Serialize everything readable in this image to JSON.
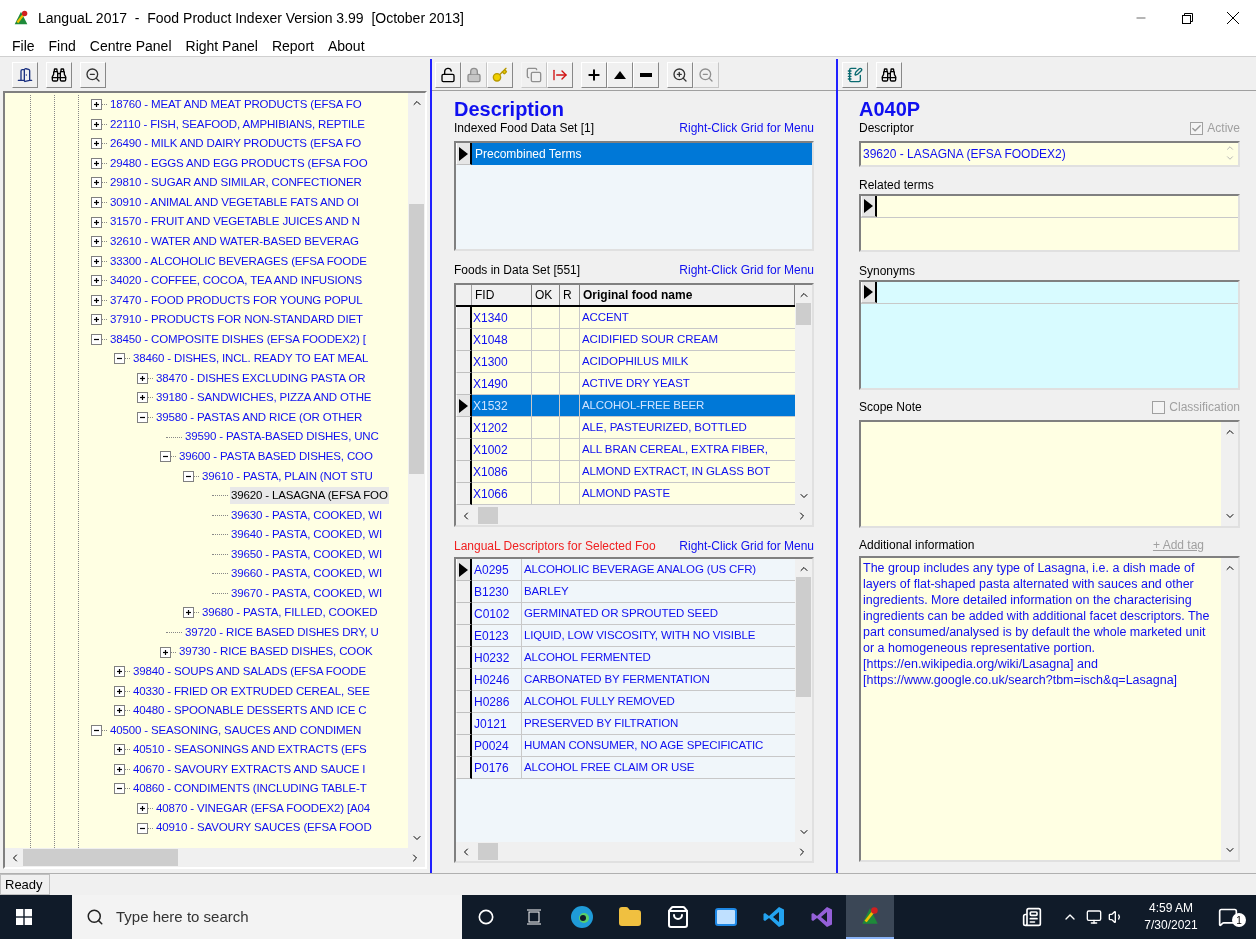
{
  "window": {
    "title": "LanguaL 2017  -  Food Product Indexer Version 3.99  [October 2013]"
  },
  "menu": [
    "File",
    "Find",
    "Centre Panel",
    "Right Panel",
    "Report",
    "About"
  ],
  "tree": [
    {
      "label": "18760 - MEAT AND MEAT PRODUCTS (EFSA FO",
      "kind": "branch",
      "expanded": false,
      "selected": false
    },
    {
      "label": "22110 - FISH, SEAFOOD, AMPHIBIANS, REPTILE",
      "kind": "branch",
      "expanded": false,
      "selected": false
    },
    {
      "label": "26490 - MILK AND DAIRY PRODUCTS (EFSA FO",
      "kind": "branch",
      "expanded": false,
      "selected": false
    },
    {
      "label": "29480 - EGGS AND EGG PRODUCTS (EFSA FOO",
      "kind": "branch",
      "expanded": false,
      "selected": false
    },
    {
      "label": "29810 - SUGAR AND SIMILAR, CONFECTIONER",
      "kind": "branch",
      "expanded": false,
      "selected": false
    },
    {
      "label": "30910 - ANIMAL AND VEGETABLE FATS AND OI",
      "kind": "branch",
      "expanded": false,
      "selected": false
    },
    {
      "label": "31570 - FRUIT AND VEGETABLE JUICES AND N",
      "kind": "branch",
      "expanded": false,
      "selected": false
    },
    {
      "label": "32610 - WATER AND WATER-BASED BEVERAG",
      "kind": "branch",
      "expanded": false,
      "selected": false
    },
    {
      "label": "33300 - ALCOHOLIC BEVERAGES (EFSA FOODE",
      "kind": "branch",
      "expanded": false,
      "selected": false
    },
    {
      "label": "34020 - COFFEE, COCOA, TEA AND INFUSIONS",
      "kind": "branch",
      "expanded": false,
      "selected": false
    },
    {
      "label": "37470 - FOOD PRODUCTS FOR YOUNG POPUL",
      "kind": "branch",
      "expanded": false,
      "selected": false
    },
    {
      "label": "37910 - PRODUCTS FOR NON-STANDARD DIET",
      "kind": "branch",
      "expanded": false,
      "selected": false
    },
    {
      "label": "38450 - COMPOSITE DISHES (EFSA FOODEX2) [",
      "kind": "branch",
      "expanded": true,
      "selected": false,
      "children": [
        {
          "label": "38460 - DISHES, INCL. READY TO EAT MEAL",
          "kind": "branch",
          "expanded": true,
          "selected": false,
          "children": [
            {
              "label": "38470 - DISHES EXCLUDING PASTA OR",
              "kind": "branch",
              "expanded": false,
              "selected": false
            },
            {
              "label": "39180 - SANDWICHES, PIZZA AND OTHE",
              "kind": "branch",
              "expanded": false,
              "selected": false
            },
            {
              "label": "39580 - PASTAS AND RICE (OR OTHER",
              "kind": "branch",
              "expanded": true,
              "selected": false,
              "children": [
                {
                  "label": "39590 - PASTA-BASED DISHES, UNC",
                  "kind": "leaf",
                  "selected": false
                },
                {
                  "label": "39600 - PASTA BASED DISHES, COO",
                  "kind": "branch",
                  "expanded": true,
                  "selected": false,
                  "children": [
                    {
                      "label": "39610 - PASTA, PLAIN (NOT STU",
                      "kind": "branch",
                      "expanded": true,
                      "selected": false,
                      "children": [
                        {
                          "label": "39620 - LASAGNA (EFSA FOO",
                          "kind": "leaf",
                          "selected": true
                        },
                        {
                          "label": "39630 - PASTA, COOKED, WI",
                          "kind": "leaf",
                          "selected": false
                        },
                        {
                          "label": "39640 - PASTA, COOKED, WI",
                          "kind": "leaf",
                          "selected": false
                        },
                        {
                          "label": "39650 - PASTA, COOKED, WI",
                          "kind": "leaf",
                          "selected": false
                        },
                        {
                          "label": "39660 - PASTA, COOKED, WI",
                          "kind": "leaf",
                          "selected": false
                        },
                        {
                          "label": "39670 - PASTA, COOKED, WI",
                          "kind": "leaf",
                          "selected": false
                        }
                      ]
                    },
                    {
                      "label": "39680 - PASTA, FILLED, COOKED",
                      "kind": "branch",
                      "expanded": false,
                      "selected": false
                    }
                  ]
                },
                {
                  "label": "39720 - RICE BASED DISHES DRY, U",
                  "kind": "leaf",
                  "selected": false
                },
                {
                  "label": "39730 - RICE BASED DISHES, COOK",
                  "kind": "branch",
                  "expanded": false,
                  "selected": false
                }
              ]
            }
          ]
        },
        {
          "label": "39840 - SOUPS AND SALADS (EFSA FOODE",
          "kind": "branch",
          "expanded": false,
          "selected": false
        },
        {
          "label": "40330 - FRIED OR EXTRUDED CEREAL, SEE",
          "kind": "branch",
          "expanded": false,
          "selected": false
        },
        {
          "label": "40480 - SPOONABLE DESSERTS AND ICE C",
          "kind": "branch",
          "expanded": false,
          "selected": false
        }
      ]
    },
    {
      "label": "40500 - SEASONING, SAUCES AND CONDIMEN",
      "kind": "branch",
      "expanded": true,
      "selected": false,
      "children": [
        {
          "label": "40510 - SEASONINGS AND EXTRACTS (EFS",
          "kind": "branch",
          "expanded": false,
          "selected": false
        },
        {
          "label": "40670 - SAVOURY EXTRACTS AND SAUCE I",
          "kind": "branch",
          "expanded": false,
          "selected": false
        },
        {
          "label": "40860 - CONDIMENTS (INCLUDING TABLE-T",
          "kind": "branch",
          "expanded": true,
          "selected": false,
          "children": [
            {
              "label": "40870 - VINEGAR (EFSA FOODEX2) [A04",
              "kind": "branch",
              "expanded": false,
              "selected": false
            },
            {
              "label": "40910 - SAVOURY SAUCES (EFSA FOOD",
              "kind": "branch",
              "expanded": true,
              "selected": false
            }
          ]
        }
      ]
    }
  ],
  "center": {
    "toolbar": [
      {
        "disabled": false
      },
      {
        "disabled": true
      },
      {
        "disabled": false
      },
      {
        "disabled": true
      },
      {
        "disabled": false
      },
      {
        "disabled": false
      },
      {
        "disabled": false
      },
      {
        "disabled": false
      },
      {
        "disabled": false
      },
      {
        "disabled": true
      }
    ],
    "heading": "Description",
    "indexed": {
      "label": "Indexed Food Data Set [1]",
      "hint": "Right-Click Grid for Menu",
      "rows": [
        {
          "name": "Precombined Terms",
          "selected": true
        }
      ]
    },
    "foods": {
      "label": "Foods in Data Set [551]",
      "hint": "Right-Click Grid for Menu",
      "columns": [
        "FID",
        "OK",
        "R",
        "Original food name"
      ],
      "rows": [
        {
          "fid": "X1340",
          "name": "ACCENT",
          "selected": false
        },
        {
          "fid": "X1048",
          "name": "ACIDIFIED SOUR CREAM",
          "selected": false
        },
        {
          "fid": "X1300",
          "name": "ACIDOPHILUS MILK",
          "selected": false
        },
        {
          "fid": "X1490",
          "name": "ACTIVE DRY YEAST",
          "selected": false
        },
        {
          "fid": "X1532",
          "name": "ALCOHOL-FREE BEER",
          "selected": true
        },
        {
          "fid": "X1202",
          "name": "ALE, PASTEURIZED, BOTTLED",
          "selected": false
        },
        {
          "fid": "X1002",
          "name": "ALL BRAN CEREAL, EXTRA FIBER,",
          "selected": false
        },
        {
          "fid": "X1086",
          "name": "ALMOND EXTRACT, IN GLASS BOT",
          "selected": false
        },
        {
          "fid": "X1066",
          "name": "ALMOND PASTE",
          "selected": false
        }
      ]
    },
    "descriptors": {
      "label": "LanguaL Descriptors for Selected Foo",
      "hint": "Right-Click Grid for Menu",
      "rows": [
        {
          "code": "A0295",
          "name": "ALCOHOLIC BEVERAGE ANALOG (US CFR)",
          "current": true
        },
        {
          "code": "B1230",
          "name": "BARLEY",
          "current": false
        },
        {
          "code": "C0102",
          "name": "GERMINATED OR SPROUTED SEED",
          "current": false
        },
        {
          "code": "E0123",
          "name": "LIQUID, LOW VISCOSITY, WITH NO VISIBLE",
          "current": false
        },
        {
          "code": "H0232",
          "name": "ALCOHOL FERMENTED",
          "current": false
        },
        {
          "code": "H0246",
          "name": "CARBONATED BY FERMENTATION",
          "current": false
        },
        {
          "code": "H0286",
          "name": "ALCOHOL FULLY REMOVED",
          "current": false
        },
        {
          "code": "J0121",
          "name": "PRESERVED BY FILTRATION",
          "current": false
        },
        {
          "code": "P0024",
          "name": "HUMAN CONSUMER, NO AGE SPECIFICATIC",
          "current": false
        },
        {
          "code": "P0176",
          "name": "ALCOHOL FREE CLAIM OR USE",
          "current": false
        }
      ]
    }
  },
  "right": {
    "heading": "A040P",
    "descriptor": {
      "label": "Descriptor",
      "value": "39620 - LASAGNA (EFSA FOODEX2)"
    },
    "active": {
      "label": "Active",
      "checked": true,
      "disabled": true
    },
    "related_terms": {
      "label": "Related terms"
    },
    "synonyms": {
      "label": "Synonyms"
    },
    "scope_note": {
      "label": "Scope Note"
    },
    "classification": {
      "label": "Classification",
      "checked": false,
      "disabled": true
    },
    "additional": {
      "label": "Additional information",
      "link": "+ Add tag",
      "text": "The group includes any type of Lasagna, i.e. a dish made of layers of flat-shaped pasta alternated with sauces and other ingredients. More detailed information on the characterising ingredients can be added with additional facet descriptors. The part consumed/analysed is by default the whole marketed unit or a homogeneous representative portion. [https://en.wikipedia.org/wiki/Lasagna] and [https://www.google.co.uk/search?tbm=isch&q=Lasagna]"
    }
  },
  "status_bar": "Ready",
  "taskbar": {
    "search_placeholder": "Type here to search",
    "time": "4:59 AM",
    "date": "7/30/2021",
    "notifications": "1"
  }
}
